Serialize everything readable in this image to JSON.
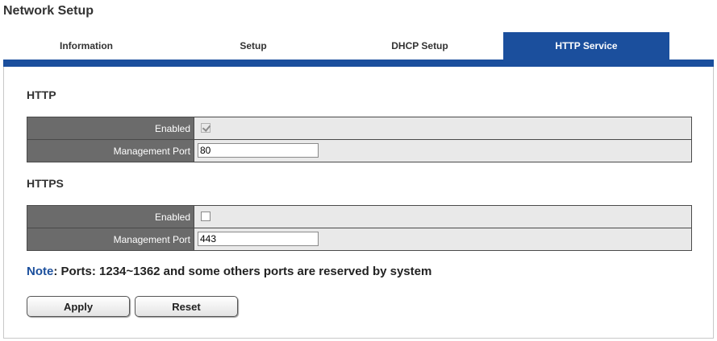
{
  "page": {
    "title": "Network Setup"
  },
  "tabs": [
    {
      "label": "Information",
      "active": false
    },
    {
      "label": "Setup",
      "active": false
    },
    {
      "label": "DHCP Setup",
      "active": false
    },
    {
      "label": "HTTP Service",
      "active": true
    }
  ],
  "http": {
    "title": "HTTP",
    "enabled_label": "Enabled",
    "enabled": true,
    "port_label": "Management Port",
    "port_value": "80"
  },
  "https": {
    "title": "HTTPS",
    "enabled_label": "Enabled",
    "enabled": false,
    "port_label": "Management Port",
    "port_value": "443"
  },
  "note": {
    "label": "Note",
    "text": ": Ports: 1234~1362 and some others ports are reserved by system"
  },
  "buttons": {
    "apply": "Apply",
    "reset": "Reset"
  },
  "colors": {
    "accent": "#1b4f9d",
    "label_bg": "#6b6b6b",
    "field_bg": "#e9e9e9"
  }
}
